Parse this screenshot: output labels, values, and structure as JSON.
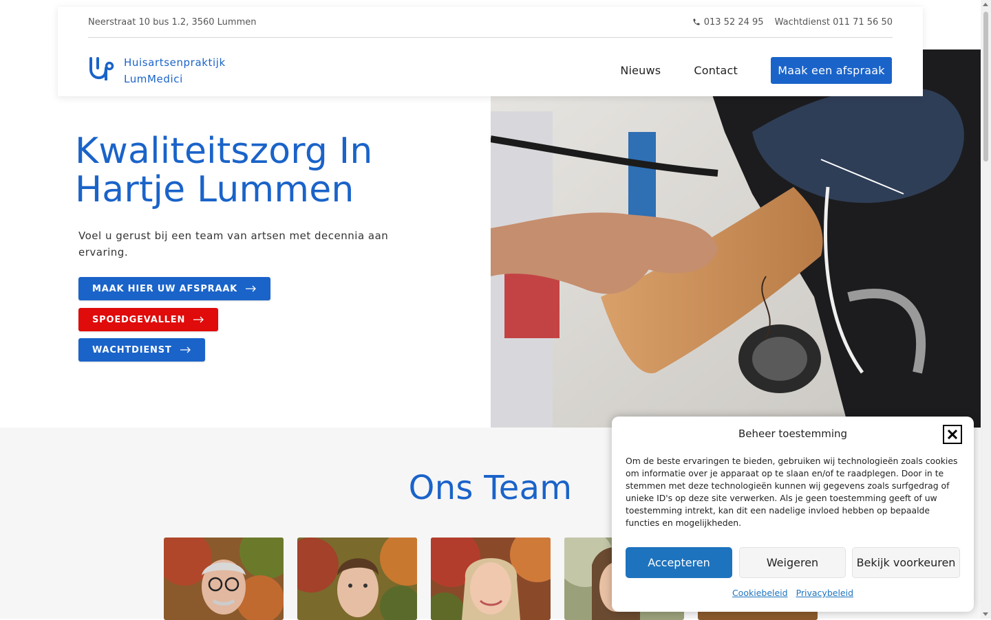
{
  "topbar": {
    "address": "Neerstraat 10 bus 1.2, 3560 Lummen",
    "phone": "013 52 24 95",
    "wachtdienst": "Wachtdienst 011 71 56 50"
  },
  "brand": {
    "line1": "Huisartsenpraktijk",
    "line2": "LumMedici",
    "icon": "stethoscope-icon"
  },
  "nav": {
    "items": [
      {
        "label": "Nieuws"
      },
      {
        "label": "Contact"
      }
    ],
    "cta": "Maak een afspraak"
  },
  "hero": {
    "title_line1": "Kwaliteitszorg In",
    "title_line2": "Hartje Lummen",
    "subtitle": "Voel u gerust bij een team van artsen met decennia aan ervaring.",
    "buttons": [
      {
        "label": "MAAK HIER UW AFSPRAAK",
        "color": "#1a63c9"
      },
      {
        "label": "SPOEDGEVALLEN",
        "color": "#e00b0b"
      },
      {
        "label": "WACHTDIENST",
        "color": "#1a63c9"
      }
    ]
  },
  "team": {
    "title": "Ons Team"
  },
  "consent": {
    "title": "Beheer toestemming",
    "text": "Om de beste ervaringen te bieden, gebruiken wij technologieën zoals cookies om informatie over je apparaat op te slaan en/of te raadplegen. Door in te stemmen met deze technologieën kunnen wij gegevens zoals surfgedrag of unieke ID's op deze site verwerken. Als je geen toestemming geeft of uw toestemming intrekt, kan dit een nadelige invloed hebben op bepaalde functies en mogelijkheden.",
    "accept": "Accepteren",
    "deny": "Weigeren",
    "prefs": "Bekijk voorkeuren",
    "link_cookie": "Cookiebeleid",
    "link_privacy": "Privacybeleid"
  },
  "colors": {
    "brand_blue": "#1a63c9",
    "emergency_red": "#e00b0b",
    "consent_blue": "#1e73be"
  }
}
